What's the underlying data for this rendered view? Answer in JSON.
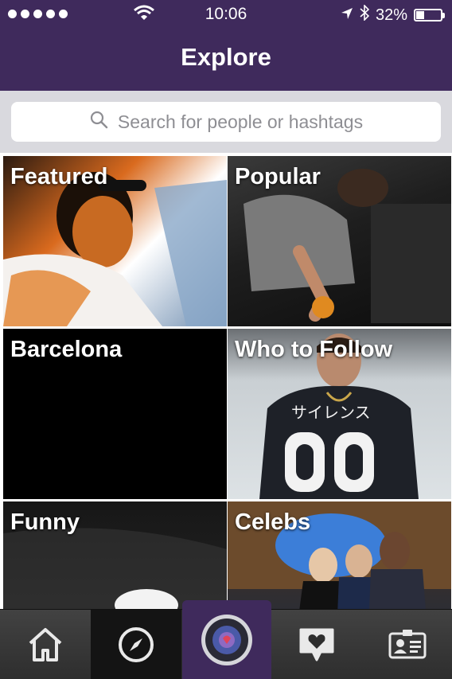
{
  "status_bar": {
    "time": "10:06",
    "battery": "32%",
    "battery_level": 0.32
  },
  "header": {
    "title": "Explore"
  },
  "search": {
    "placeholder": "Search for people or hashtags"
  },
  "tiles": [
    {
      "label": "Featured"
    },
    {
      "label": "Popular"
    },
    {
      "label": "Barcelona"
    },
    {
      "label": "Who to Follow"
    },
    {
      "label": "Funny"
    },
    {
      "label": "Celebs"
    }
  ],
  "tab_bar": {
    "tabs": [
      {
        "icon": "home-icon"
      },
      {
        "icon": "compass-icon"
      },
      {
        "icon": "camera-icon"
      },
      {
        "icon": "heart-speech-icon"
      },
      {
        "icon": "profile-card-icon"
      }
    ],
    "accent": "#3f2a5c"
  }
}
